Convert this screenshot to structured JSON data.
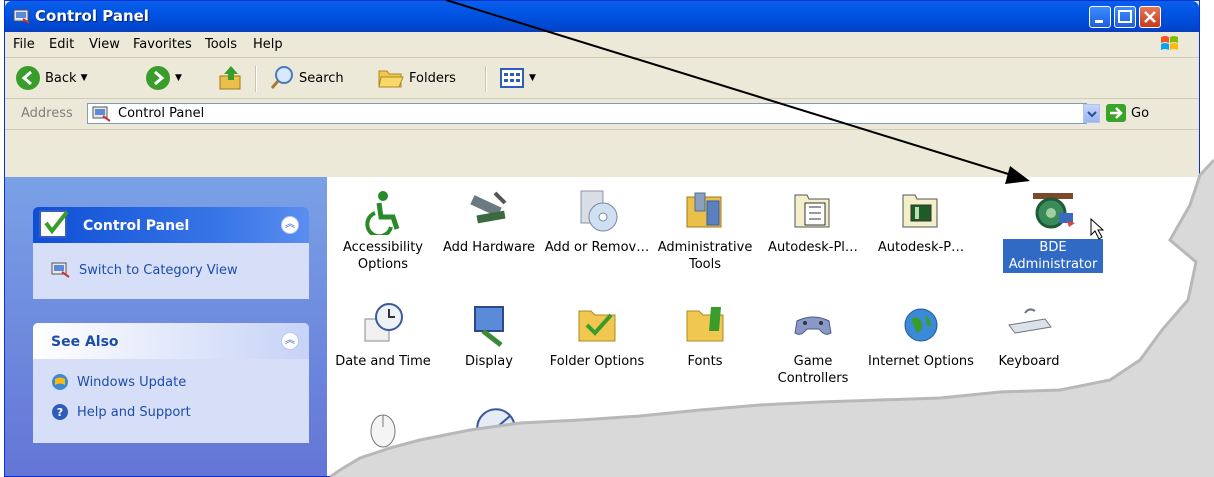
{
  "window": {
    "title": "Control Panel"
  },
  "menu": [
    "File",
    "Edit",
    "View",
    "Favorites",
    "Tools",
    "Help"
  ],
  "toolbar": {
    "back": "Back",
    "search": "Search",
    "folders": "Folders"
  },
  "address": {
    "label": "Address",
    "value": "Control Panel",
    "go": "Go"
  },
  "sidebar": {
    "panel1": {
      "title": "Control Panel",
      "link": "Switch to Category View"
    },
    "panel2": {
      "title": "See Also",
      "links": [
        "Windows Update",
        "Help and Support"
      ]
    }
  },
  "items": {
    "row1": [
      {
        "label": "Accessibility Options",
        "icon": "accessibility-icon"
      },
      {
        "label": "Add Hardware",
        "icon": "add-hardware-icon"
      },
      {
        "label": "Add or Remov…",
        "icon": "add-remove-programs-icon"
      },
      {
        "label": "Administrative Tools",
        "icon": "administrative-tools-icon"
      },
      {
        "label": "Autodesk-Pl…",
        "icon": "autodesk-plot-icon"
      },
      {
        "label": "Autodesk-P…",
        "icon": "autodesk-pc3-icon"
      },
      {
        "label": "BDE Administrator",
        "icon": "bde-administrator-icon",
        "selected": true
      }
    ],
    "row2": [
      {
        "label": "Date and Time",
        "icon": "date-time-icon"
      },
      {
        "label": "Display",
        "icon": "display-icon"
      },
      {
        "label": "Folder Options",
        "icon": "folder-options-icon"
      },
      {
        "label": "Fonts",
        "icon": "fonts-icon"
      },
      {
        "label": "Game Controllers",
        "icon": "game-controllers-icon"
      },
      {
        "label": "Internet Options",
        "icon": "internet-options-icon"
      },
      {
        "label": "Keyboard",
        "icon": "keyboard-icon"
      }
    ],
    "row3": [
      {
        "label": "Mouse",
        "icon": "mouse-icon"
      }
    ]
  },
  "colors": {
    "titlebar": "#0054e3",
    "sidebar": "#6f8ee0",
    "selection": "#316ac5"
  }
}
